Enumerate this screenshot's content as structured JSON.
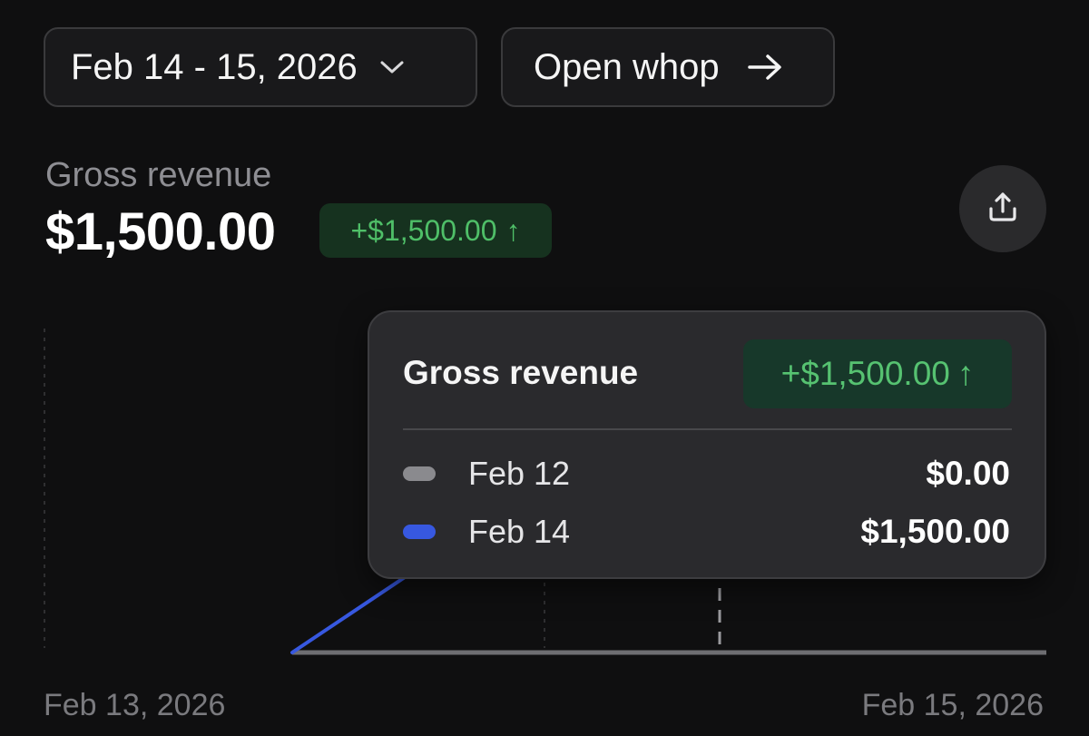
{
  "toolbar": {
    "date_range_label": "Feb 14 - 15, 2026",
    "open_label": "Open whop"
  },
  "metric": {
    "label": "Gross revenue",
    "value": "$1,500.00",
    "change": "+$1,500.00",
    "change_arrow": "↑"
  },
  "icons": {
    "date_dropdown": "chevron-down-icon",
    "open": "arrow-right-icon",
    "export": "share-upload-icon"
  },
  "tooltip": {
    "title": "Gross revenue",
    "change": "+$1,500.00",
    "change_arrow": "↑",
    "rows": [
      {
        "date": "Feb 12",
        "amount": "$0.00",
        "color": "#8a8a8e"
      },
      {
        "date": "Feb 14",
        "amount": "$1,500.00",
        "color": "#3758e0"
      }
    ]
  },
  "axis": {
    "start": "Feb 13, 2026",
    "end": "Feb 15, 2026"
  },
  "colors": {
    "background": "#0f0f10",
    "positive": "#4fbf68",
    "positive_bg": "#16321f",
    "series_current": "#3758e0",
    "series_previous": "#8a8a8e"
  }
}
